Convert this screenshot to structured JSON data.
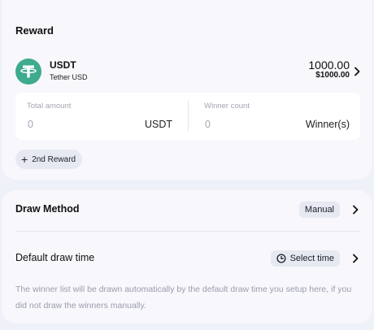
{
  "reward": {
    "title": "Reward",
    "token": {
      "symbol": "USDT",
      "name": "Tether USD",
      "amount": "1000.00",
      "usd_value": "$1000.00",
      "logo_color": "#3eaa8e",
      "logo_icon": "tether-logo-icon"
    },
    "total_amount": {
      "label": "Total amount",
      "value": "0",
      "unit": "USDT"
    },
    "winner_count": {
      "label": "Winner count",
      "value": "0",
      "unit": "Winner(s)"
    },
    "add_reward_label": "2nd Reward"
  },
  "draw": {
    "method_label": "Draw Method",
    "method_value": "Manual",
    "time_label": "Default draw time",
    "time_value": "Select time",
    "note": "The winner list will be drawn automatically by the default draw time you setup here, if you did not draw the winners manually."
  },
  "colors": {
    "page_bg": "#eff1f8",
    "card_bg": "#f7f7fc",
    "pill_bg": "#e7e9f2",
    "muted_text": "#9a9dab"
  }
}
